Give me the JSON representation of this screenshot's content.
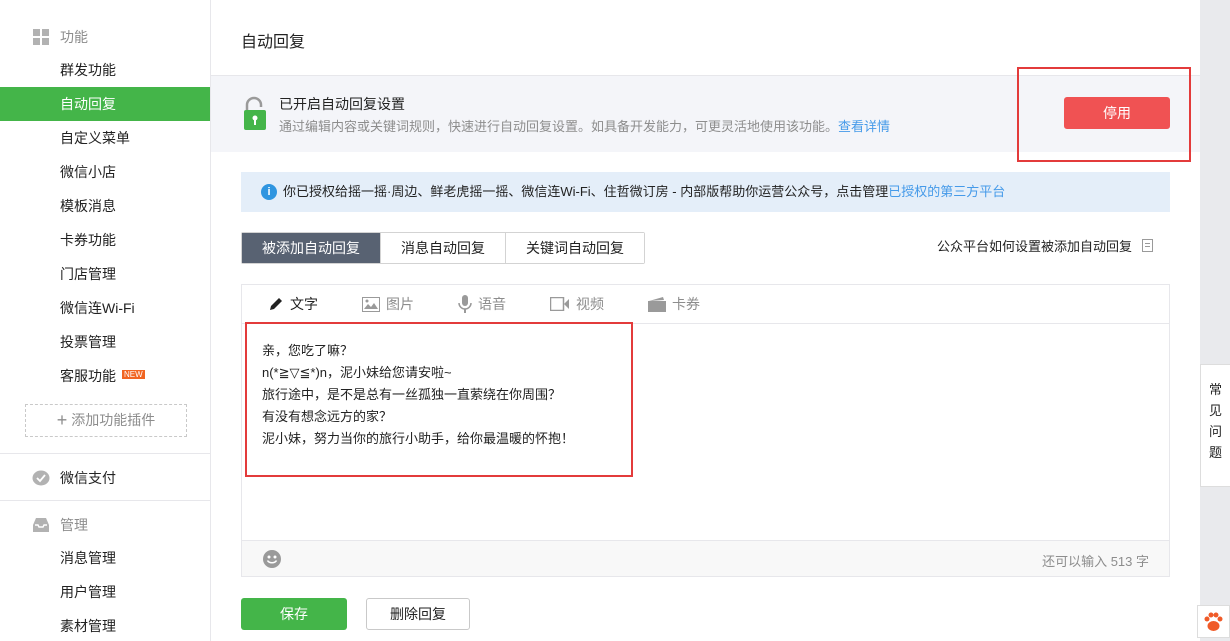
{
  "sidebar": {
    "features_title": "功能",
    "items": [
      {
        "label": "群发功能"
      },
      {
        "label": "自动回复"
      },
      {
        "label": "自定义菜单"
      },
      {
        "label": "微信小店"
      },
      {
        "label": "模板消息"
      },
      {
        "label": "卡券功能"
      },
      {
        "label": "门店管理"
      },
      {
        "label": "微信连Wi-Fi"
      },
      {
        "label": "投票管理"
      },
      {
        "label": "客服功能",
        "badge": "NEW"
      }
    ],
    "add_plugin": "添加功能插件",
    "wechat_pay": "微信支付",
    "management_title": "管理",
    "management_items": [
      {
        "label": "消息管理"
      },
      {
        "label": "用户管理"
      },
      {
        "label": "素材管理"
      }
    ]
  },
  "page": {
    "title": "自动回复"
  },
  "status": {
    "title": "已开启自动回复设置",
    "description": "通过编辑内容或关键词规则，快速进行自动回复设置。如具备开发能力，可更灵活地使用该功能。",
    "details_link": "查看详情",
    "disable_button": "停用"
  },
  "notice": {
    "text": "你已授权给摇一摇·周边、鲜老虎摇一摇、微信连Wi-Fi、住哲微订房 - 内部版帮助你运营公众号，点击管理",
    "link": "已授权的第三方平台"
  },
  "tabs": [
    {
      "label": "被添加自动回复",
      "active": true
    },
    {
      "label": "消息自动回复",
      "active": false
    },
    {
      "label": "关键词自动回复",
      "active": false
    }
  ],
  "help_link": "公众平台如何设置被添加自动回复",
  "editor": {
    "toolbar": {
      "text": "文字",
      "image": "图片",
      "voice": "语音",
      "video": "视频",
      "card": "卡券"
    },
    "content_lines": [
      "亲，您吃了嘛？",
      "n(*≧▽≦*)n，泥小妹给您请安啦~",
      "旅行途中，是不是总有一丝孤独一直萦绕在你周围？",
      "有没有想念远方的家？",
      "泥小妹，努力当你的旅行小助手，给你最温暖的怀抱！"
    ],
    "char_count": "还可以输入 513 字"
  },
  "actions": {
    "save": "保存",
    "delete": "删除回复"
  },
  "faq_tab": [
    "常",
    "见",
    "问",
    "题"
  ],
  "colors": {
    "accent_green": "#44b549",
    "danger_red": "#f05253",
    "link_blue": "#459ae9",
    "tab_active": "#586272"
  }
}
